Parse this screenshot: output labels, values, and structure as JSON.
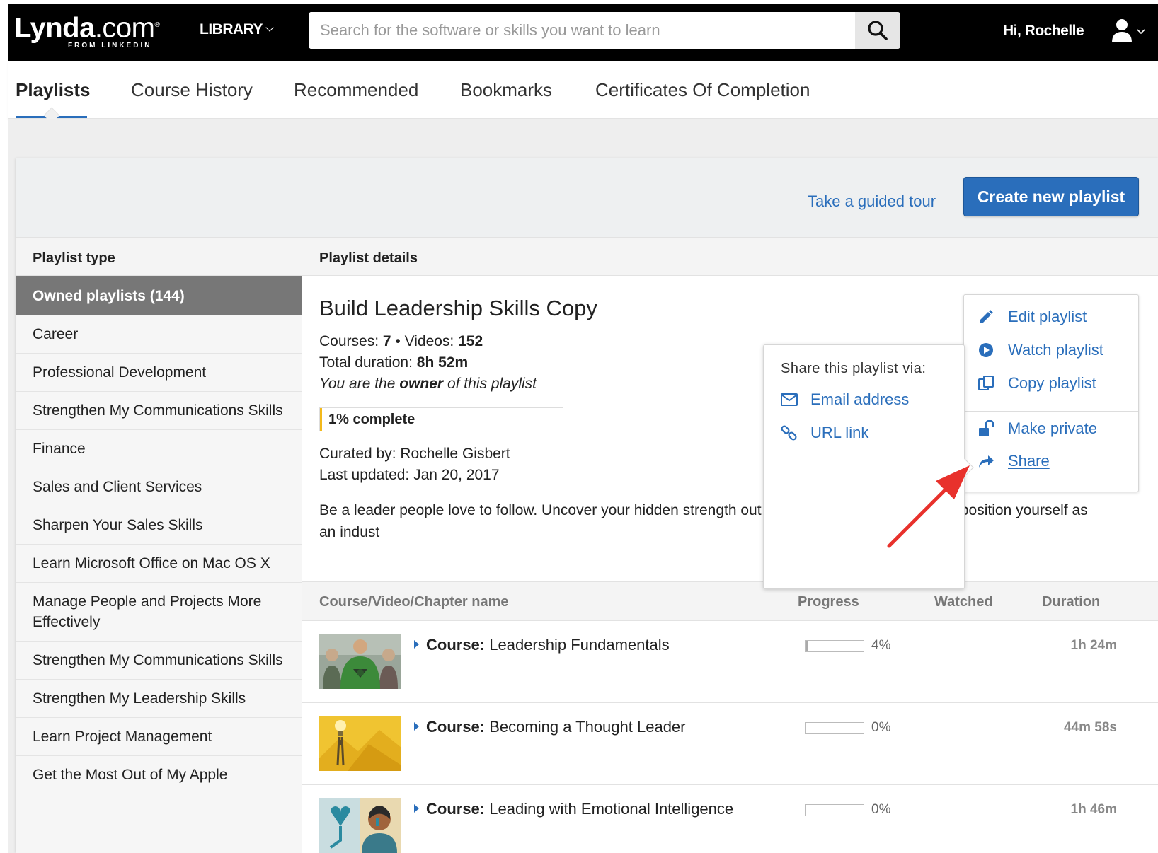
{
  "header": {
    "logo_main": "Lynda",
    "logo_suffix": ".com",
    "logo_reg": "®",
    "logo_sub": "FROM LINKEDIN",
    "library_label": "LIBRARY",
    "search_placeholder": "Search for the software or skills you want to learn",
    "greeting": "Hi, Rochelle"
  },
  "tabs": [
    {
      "label": "Playlists",
      "active": true
    },
    {
      "label": "Course History"
    },
    {
      "label": "Recommended"
    },
    {
      "label": "Bookmarks"
    },
    {
      "label": "Certificates Of Completion"
    }
  ],
  "toolbar": {
    "guided_tour": "Take a guided tour",
    "create_button": "Create new playlist"
  },
  "columns": {
    "playlist_type": "Playlist type",
    "playlist_details": "Playlist details"
  },
  "sidebar": {
    "items": [
      {
        "label": "Owned playlists (144)",
        "active": true
      },
      {
        "label": "Career"
      },
      {
        "label": "Professional Development"
      },
      {
        "label": "Strengthen My Communications Skills"
      },
      {
        "label": "Finance"
      },
      {
        "label": "Sales and Client Services"
      },
      {
        "label": "Sharpen Your Sales Skills"
      },
      {
        "label": "Learn Microsoft Office on Mac OS X"
      },
      {
        "label": "Manage People and Projects More Effectively"
      },
      {
        "label": "Strengthen My Communications Skills"
      },
      {
        "label": "Strengthen My Leadership Skills"
      },
      {
        "label": "Learn Project Management"
      },
      {
        "label": "Get the Most Out of My Apple"
      }
    ]
  },
  "playlist": {
    "title": "Build Leadership Skills Copy",
    "courses_label": "Courses:",
    "courses_value": "7",
    "videos_label": "Videos:",
    "videos_value": "152",
    "duration_label": "Total duration:",
    "duration_value": "8h 52m",
    "owner_prefix": "You are the",
    "owner_word": "owner",
    "owner_suffix": "of this playlist",
    "progress_text": "1% complete",
    "progress_fraction": 0.01,
    "curated_by": "Curated by: Rochelle Gisbert",
    "last_updated": "Last updated: Jan 20, 2017",
    "description": "Be a leader people love to follow. Uncover your hidden strength out how to inspire your team and position yourself as an indust"
  },
  "table": {
    "headers": {
      "name": "Course/Video/Chapter name",
      "progress": "Progress",
      "watched": "Watched",
      "duration": "Duration"
    },
    "rows": [
      {
        "kind": "Course:",
        "title": "Leadership Fundamentals",
        "progress": "4%",
        "progress_fraction": 0.04,
        "duration": "1h 24m"
      },
      {
        "kind": "Course:",
        "title": "Becoming a Thought Leader",
        "progress": "0%",
        "progress_fraction": 0.0,
        "duration": "44m 58s"
      },
      {
        "kind": "Course:",
        "title": "Leading with Emotional Intelligence",
        "progress": "0%",
        "progress_fraction": 0.0,
        "duration": "1h 46m"
      }
    ]
  },
  "actions_menu": {
    "edit": "Edit playlist",
    "watch": "Watch playlist",
    "copy": "Copy playlist",
    "make_private": "Make private",
    "share": "Share"
  },
  "share_popup": {
    "title": "Share this playlist via:",
    "email": "Email address",
    "url": "URL link"
  },
  "colors": {
    "accent": "#2a6ebb",
    "progress": "#f3b91b",
    "annotation_arrow": "#e8312c"
  }
}
